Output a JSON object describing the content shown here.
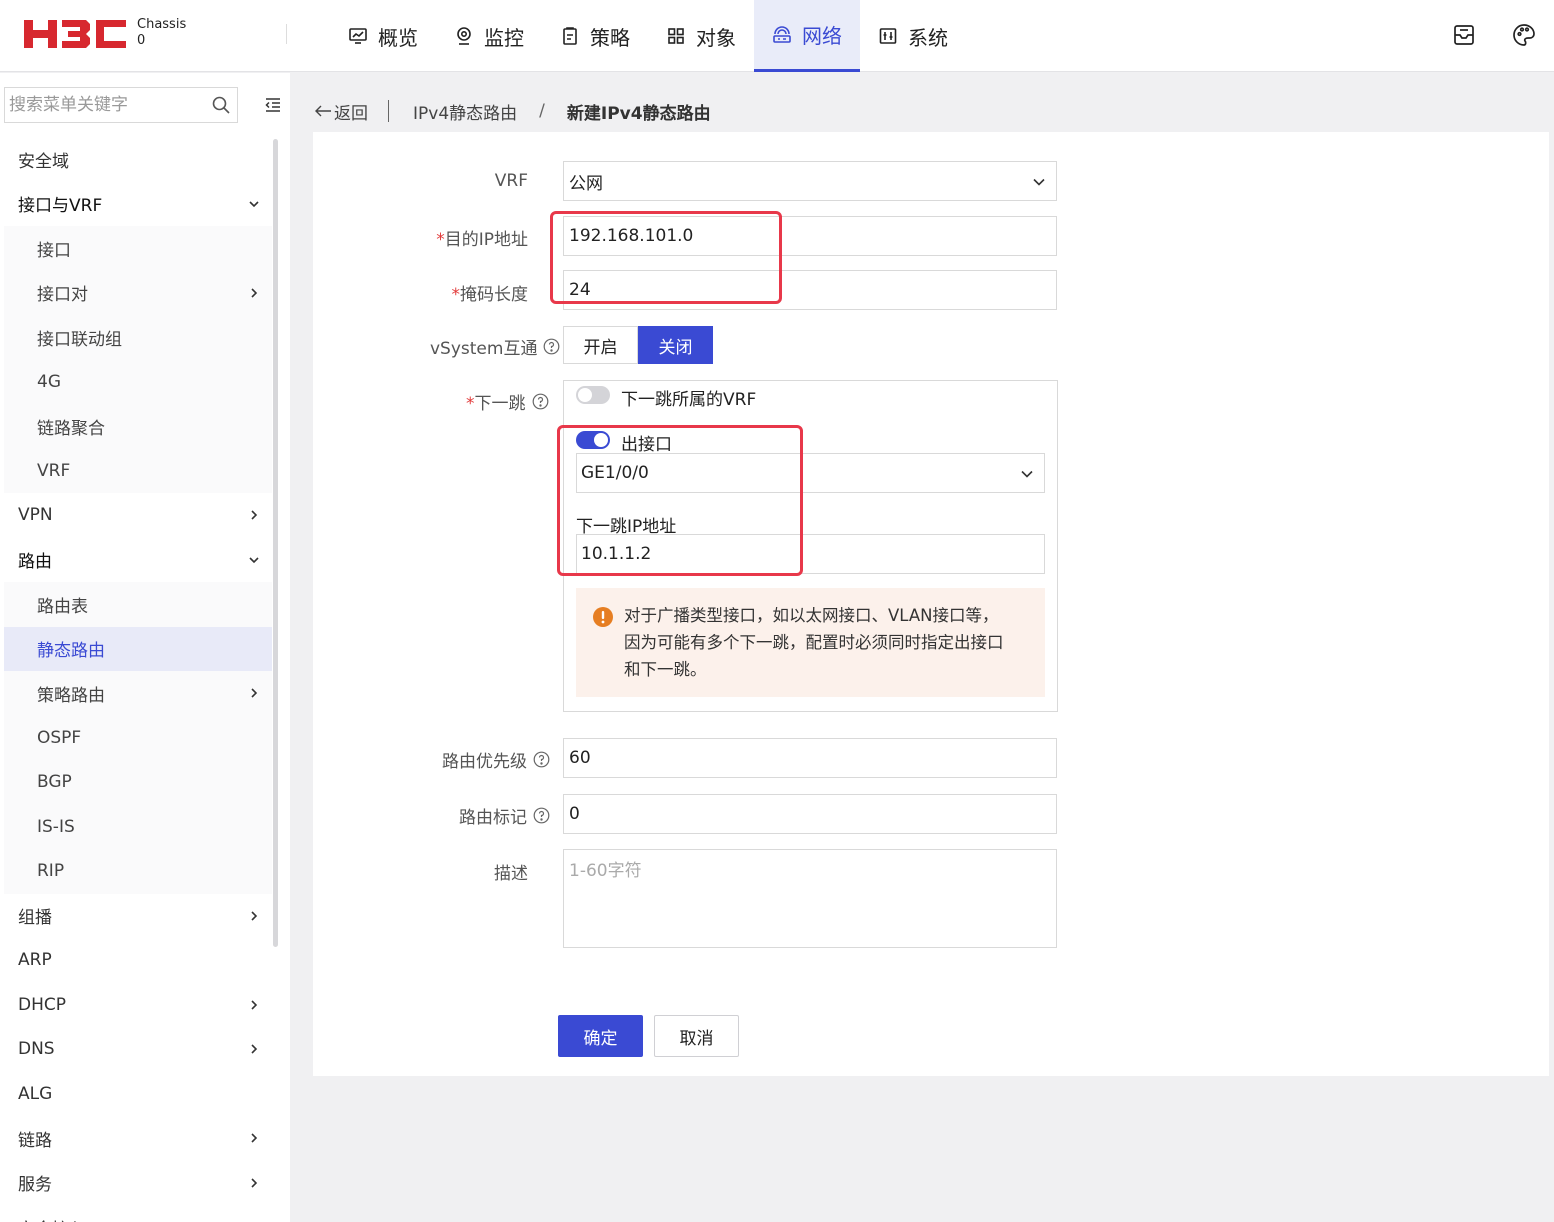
{
  "header": {
    "chassis_label": "Chassis",
    "chassis_value": "0",
    "nav": [
      {
        "label": "概览",
        "icon": "monitor-icon"
      },
      {
        "label": "监控",
        "icon": "camera-icon"
      },
      {
        "label": "策略",
        "icon": "clipboard-icon"
      },
      {
        "label": "对象",
        "icon": "grid-icon"
      },
      {
        "label": "网络",
        "icon": "network-icon",
        "active": true
      },
      {
        "label": "系统",
        "icon": "system-icon"
      }
    ]
  },
  "sidebar": {
    "search_placeholder": "搜索菜单关键字",
    "items": [
      {
        "label": "安全域"
      },
      {
        "label": "接口与VRF",
        "expanded": true
      },
      {
        "label": "接口",
        "sub": true
      },
      {
        "label": "接口对",
        "sub": true,
        "has_children": true
      },
      {
        "label": "接口联动组",
        "sub": true
      },
      {
        "label": "4G",
        "sub": true
      },
      {
        "label": "链路聚合",
        "sub": true
      },
      {
        "label": "VRF",
        "sub": true
      },
      {
        "label": "VPN",
        "has_children": true
      },
      {
        "label": "路由",
        "expanded": true
      },
      {
        "label": "路由表",
        "sub": true
      },
      {
        "label": "静态路由",
        "sub": true,
        "selected": true
      },
      {
        "label": "策略路由",
        "sub": true,
        "has_children": true
      },
      {
        "label": "OSPF",
        "sub": true
      },
      {
        "label": "BGP",
        "sub": true
      },
      {
        "label": "IS-IS",
        "sub": true
      },
      {
        "label": "RIP",
        "sub": true
      },
      {
        "label": "组播",
        "has_children": true
      },
      {
        "label": "ARP"
      },
      {
        "label": "DHCP",
        "has_children": true
      },
      {
        "label": "DNS",
        "has_children": true
      },
      {
        "label": "ALG"
      },
      {
        "label": "链路",
        "has_children": true
      },
      {
        "label": "服务",
        "has_children": true
      },
      {
        "label": "安全接入",
        "has_children": true
      }
    ]
  },
  "breadcrumb": {
    "back": "返回",
    "parent": "IPv4静态路由",
    "separator": "/",
    "current": "新建IPv4静态路由"
  },
  "form": {
    "vrf": {
      "label": "VRF",
      "value": "公网"
    },
    "dest_ip": {
      "required": "*",
      "label": "目的IP地址",
      "value": "192.168.101.0"
    },
    "mask": {
      "required": "*",
      "label": "掩码长度",
      "value": "24"
    },
    "vsystem": {
      "label": "vSystem互通",
      "on_label": "开启",
      "off_label": "关闭",
      "selected": "关闭"
    },
    "nexthop": {
      "required": "*",
      "label": "下一跳",
      "vrf_toggle_label": "下一跳所属的VRF",
      "vrf_toggle_on": false,
      "out_iface_toggle_label": "出接口",
      "out_iface_toggle_on": true,
      "out_iface_value": "GE1/0/0",
      "ip_label": "下一跳IP地址",
      "ip_value": "10.1.1.2",
      "warning_lines": [
        "对于广播类型接口，如以太网接口、VLAN接口等，",
        "因为可能有多个下一跳，配置时必须同时指定出接口",
        "和下一跳。"
      ]
    },
    "priority": {
      "label": "路由优先级",
      "value": "60"
    },
    "tag": {
      "label": "路由标记",
      "value": "0"
    },
    "description": {
      "label": "描述",
      "placeholder": "1-60字符"
    },
    "ok_label": "确定",
    "cancel_label": "取消"
  },
  "colors": {
    "accent": "#3a4ad3",
    "highlight": "#e8384a",
    "warning_bg": "#fcf1eb",
    "warning_icon": "#e67e22",
    "logo": "#d7282f"
  }
}
